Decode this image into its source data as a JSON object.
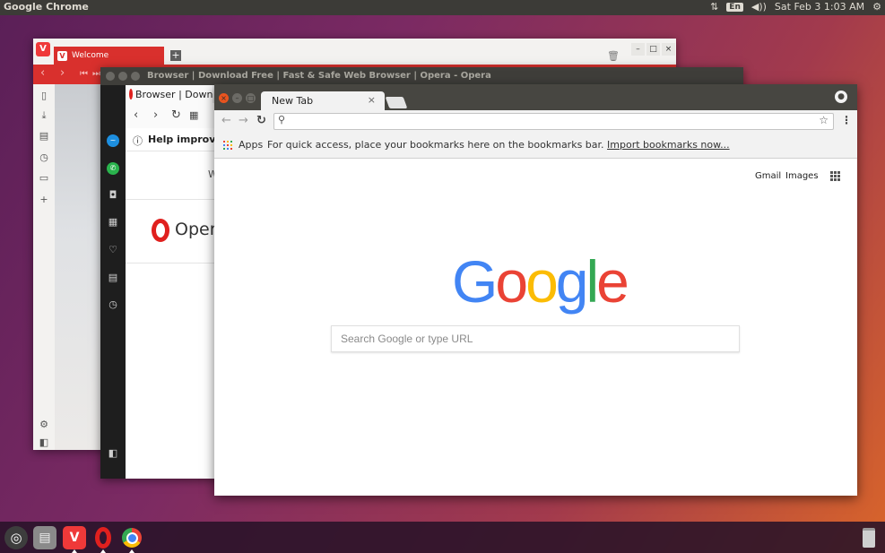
{
  "top_panel": {
    "title": "Google Chrome",
    "keyboard": "En",
    "datetime": "Sat Feb 3 1:03 AM"
  },
  "vivaldi": {
    "tab_label": "Welcome"
  },
  "opera": {
    "window_title": "Browser | Download Free | Fast & Safe Web Browser | Opera - Opera",
    "tab_label": "Browser | Downlo",
    "help_text": "Help improve O",
    "truncated_w": "W",
    "logo_text": "Opera"
  },
  "chrome": {
    "tab_label": "New Tab",
    "omnibox_value": "",
    "apps_label": "Apps",
    "bookmarks_hint": "For quick access, place your bookmarks here on the bookmarks bar.",
    "import_link": "Import bookmarks now...",
    "gmail": "Gmail",
    "images": "Images",
    "search_placeholder": "Search Google or type URL",
    "logo_letters": [
      {
        "ch": "G",
        "color": "#4285F4"
      },
      {
        "ch": "o",
        "color": "#EA4335"
      },
      {
        "ch": "o",
        "color": "#FBBC05"
      },
      {
        "ch": "g",
        "color": "#4285F4"
      },
      {
        "ch": "l",
        "color": "#34A853"
      },
      {
        "ch": "e",
        "color": "#EA4335"
      }
    ]
  },
  "colors": {
    "vivaldi_red": "#d9302d",
    "opera_red": "#e0201e"
  }
}
